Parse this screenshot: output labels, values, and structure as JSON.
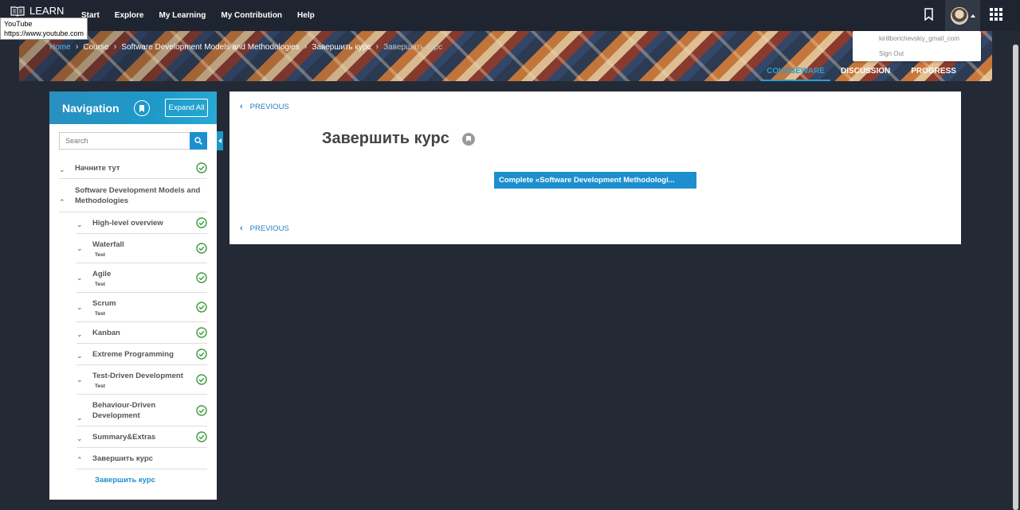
{
  "app": {
    "logo_text": "LEARN"
  },
  "top_nav": [
    "Start",
    "Explore",
    "My Learning",
    "My Contribution",
    "Help"
  ],
  "tooltip": {
    "title": "YouTube",
    "url": "https://www.youtube.com"
  },
  "user_menu": {
    "email": "kirillborichevskiy_gmail_com",
    "sign_out": "Sign Out"
  },
  "breadcrumb": {
    "home": "Home",
    "course": "Course",
    "section": "Software Development Models and Methodologies",
    "subsection": "Завершить курс",
    "current": "Завершить курс"
  },
  "course_tabs": {
    "courseware": "COURSEWARE",
    "discussion": "DISCUSSION",
    "progress": "PROGRESS"
  },
  "navigation": {
    "title": "Navigation",
    "expand_all": "Expand All",
    "search_placeholder": "Search",
    "items": [
      {
        "label": "Начните тут",
        "level": 0,
        "expanded": false,
        "completed": true
      },
      {
        "label": "Software Development Models and Methodologies",
        "level": 0,
        "expanded": true,
        "completed": false
      },
      {
        "label": "High-level overview",
        "level": 1,
        "completed": true
      },
      {
        "label": "Waterfall",
        "sub": "Test",
        "level": 1,
        "completed": true
      },
      {
        "label": "Agile",
        "sub": "Test",
        "level": 1,
        "completed": true
      },
      {
        "label": "Scrum",
        "sub": "Test",
        "level": 1,
        "completed": true
      },
      {
        "label": "Kanban",
        "level": 1,
        "completed": true
      },
      {
        "label": "Extreme Programming",
        "level": 1,
        "completed": true
      },
      {
        "label": "Test-Driven Development",
        "sub": "Test",
        "level": 1,
        "completed": true
      },
      {
        "label": "Behaviour-Driven Development",
        "level": 1,
        "completed": true
      },
      {
        "label": "Summary&Extras",
        "level": 1,
        "completed": true
      },
      {
        "label": "Завершить курс",
        "level": 1,
        "expanded": true,
        "completed": false
      }
    ],
    "active_leaf": "Завершить курс"
  },
  "content": {
    "previous": "PREVIOUS",
    "unit_title": "Завершить курс",
    "complete_button": "Complete  «Software Development Methodologi..."
  },
  "colors": {
    "accent": "#1d8fcf",
    "check": "#3a9a3a",
    "page_bg": "#232a35",
    "topbar": "#1f2530"
  }
}
